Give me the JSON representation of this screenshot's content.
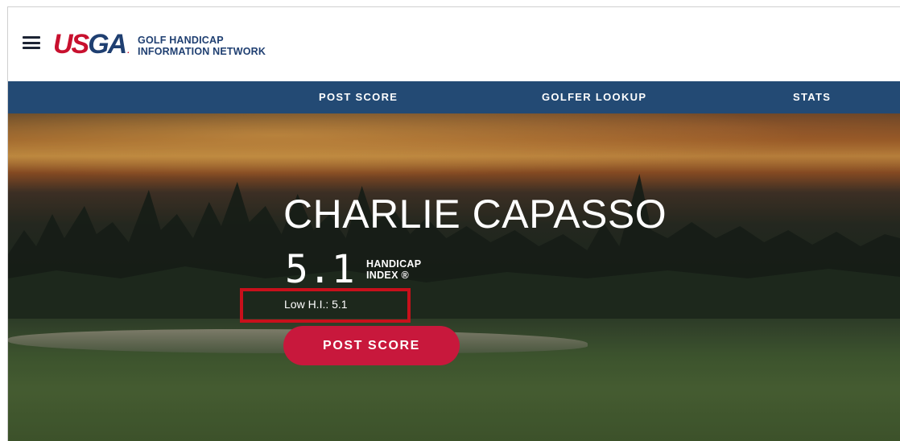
{
  "header": {
    "logo_text_us": "US",
    "logo_text_ga": "GA",
    "logo_registered": ".",
    "network_line1": "GOLF HANDICAP",
    "network_line2": "INFORMATION NETWORK"
  },
  "nav": {
    "items": [
      {
        "label": "POST SCORE"
      },
      {
        "label": "GOLFER LOOKUP"
      },
      {
        "label": "STATS"
      }
    ]
  },
  "golfer": {
    "name": "CHARLIE CAPASSO",
    "handicap_index": "5.1",
    "handicap_label_line1": "HANDICAP",
    "handicap_label_line2": "INDEX ®",
    "low_hi": "Low H.I.: 5.1"
  },
  "actions": {
    "post_score_label": "POST SCORE"
  },
  "colors": {
    "nav_bg": "#234a74",
    "brand_red": "#c8102e",
    "brand_blue": "#1f3f71",
    "button_red": "#c8183c",
    "highlight_box": "#c8101b"
  }
}
